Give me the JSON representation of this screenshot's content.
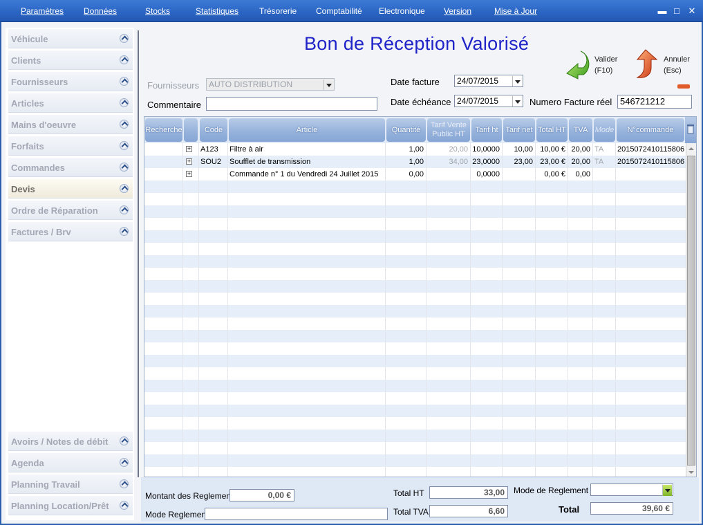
{
  "menu": {
    "items": [
      "Paramètres",
      "Données",
      "Stocks",
      "Statistiques",
      "Trésorerie",
      "Comptabilité",
      "Electronique",
      "Version",
      "Mise à Jour"
    ],
    "window_buttons": [
      "▬",
      "□",
      "✕"
    ]
  },
  "sidebar": {
    "top_items": [
      {
        "label": "Véhicule"
      },
      {
        "label": "Clients"
      },
      {
        "label": "Fournisseurs"
      },
      {
        "label": "Articles"
      },
      {
        "label": "Mains d'oeuvre"
      },
      {
        "label": "Forfaits"
      },
      {
        "label": "Commandes"
      },
      {
        "label": "Devis"
      },
      {
        "label": "Ordre de Réparation"
      },
      {
        "label": "Factures / Brv"
      }
    ],
    "bottom_items": [
      {
        "label": "Avoirs / Notes de débit"
      },
      {
        "label": "Agenda"
      },
      {
        "label": "Planning Travail"
      },
      {
        "label": "Planning Location/Prêt"
      }
    ],
    "active": "Devis"
  },
  "header": {
    "title": "Bon de Réception Valorisé",
    "validate": {
      "label": "Valider",
      "shortcut": "(F10)"
    },
    "cancel": {
      "label": "Annuler",
      "shortcut": "(Esc)"
    }
  },
  "form": {
    "supplier_label": "Fournisseurs",
    "supplier_value": "AUTO DISTRIBUTION",
    "comment_label": "Commentaire",
    "comment_value": "",
    "invoice_date_label": "Date facture",
    "invoice_date_value": "24/07/2015",
    "due_date_label": "Date échéance",
    "due_date_value": "24/07/2015",
    "real_invoice_label": "Numero Facture réel",
    "real_invoice_value": "546721212"
  },
  "grid": {
    "columns": [
      "Recherche",
      "",
      "Code",
      "Article",
      "Quantité",
      "Tarif Vente Public HT",
      "Tarif ht",
      "Tarif net",
      "Total HT",
      "TVA",
      "Mode",
      "N°commande"
    ],
    "rows": [
      {
        "code": "A123",
        "article": "Filtre à air",
        "qty": "1,00",
        "public": "20,00",
        "tarif_ht": "10,0000",
        "tarif_net": "10,00",
        "total_ht": "10,00 €",
        "tva": "20,00",
        "mode": "TA",
        "commande": "2015072410115806"
      },
      {
        "code": "SOU2",
        "article": "Soufflet de transmission",
        "qty": "1,00",
        "public": "34,00",
        "tarif_ht": "23,0000",
        "tarif_net": "23,00",
        "total_ht": "23,00 €",
        "tva": "20,00",
        "mode": "TA",
        "commande": "2015072410115806"
      },
      {
        "code": "",
        "article": "Commande n° 1 du Vendredi 24 Juillet 2015",
        "qty": "0,00",
        "public": "",
        "tarif_ht": "0,0000",
        "tarif_net": "",
        "total_ht": "0,00 €",
        "tva": "0,00",
        "mode": "",
        "commande": ""
      }
    ]
  },
  "footer": {
    "payments_label": "Montant des Reglements",
    "payments_value": "0,00 €",
    "payment_mode_label": "Mode Reglement",
    "payment_mode_value": "",
    "total_ht_label": "Total HT",
    "total_ht_value": "33,00",
    "total_tva_label": "Total TVA",
    "total_tva_value": "6,60",
    "payment_method_label": "Mode de Reglement :",
    "payment_method_value": "",
    "total_label": "Total",
    "total_value": "39,60 €"
  },
  "colors": {
    "menubar": "#2a64c2",
    "title": "#1f23c8",
    "header_cell": "#97b3dc",
    "alt_row": "#e6eff9"
  }
}
